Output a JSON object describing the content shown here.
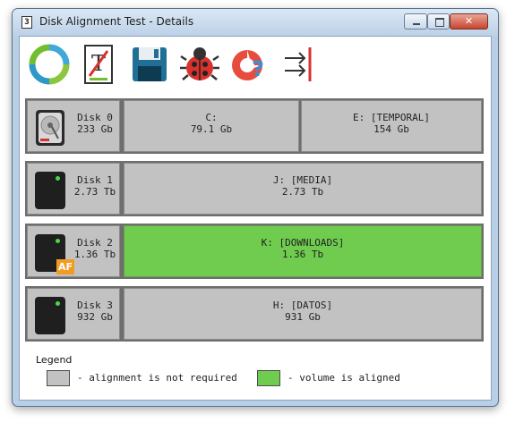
{
  "window": {
    "title": "Disk Alignment Test - Details",
    "app_icon_glyph": "3"
  },
  "controls": {
    "minimize": "minimize",
    "maximize": "maximize",
    "close": "✕"
  },
  "toolbar": [
    {
      "name": "refresh-icon",
      "label": "refresh"
    },
    {
      "name": "text-report-icon",
      "label": "report"
    },
    {
      "name": "save-icon",
      "label": "save"
    },
    {
      "name": "bug-icon",
      "label": "bug"
    },
    {
      "name": "help-icon",
      "label": "help"
    },
    {
      "name": "exit-icon",
      "label": "exit"
    }
  ],
  "disks": [
    {
      "name": "Disk 0",
      "size": "233 Gb",
      "icon": "hdd-open-icon",
      "volumes": [
        {
          "letter": "C:",
          "size": "79.1 Gb",
          "aligned": false
        },
        {
          "letter": "E: [TEMPORAL]",
          "size": "154 Gb",
          "aligned": false
        }
      ]
    },
    {
      "name": "Disk 1",
      "size": "2.73 Tb",
      "icon": "hdd-icon",
      "volumes": [
        {
          "letter": "J: [MEDIA]",
          "size": "2.73 Tb",
          "aligned": false
        }
      ]
    },
    {
      "name": "Disk 2",
      "size": "1.36 Tb",
      "icon": "hdd-af-icon",
      "badge": "AF",
      "volumes": [
        {
          "letter": "K: [DOWNLOADS]",
          "size": "1.36 Tb",
          "aligned": true
        }
      ]
    },
    {
      "name": "Disk 3",
      "size": "932 Gb",
      "icon": "hdd-icon",
      "volumes": [
        {
          "letter": "H: [DATOS]",
          "size": "931 Gb",
          "aligned": false
        }
      ]
    }
  ],
  "legend": {
    "title": "Legend",
    "not_required": "- alignment is not required",
    "aligned": "- volume is aligned"
  },
  "colors": {
    "not_required": "#c2c2c2",
    "aligned": "#6fcc4f",
    "row_frame": "#6e6e6e"
  }
}
